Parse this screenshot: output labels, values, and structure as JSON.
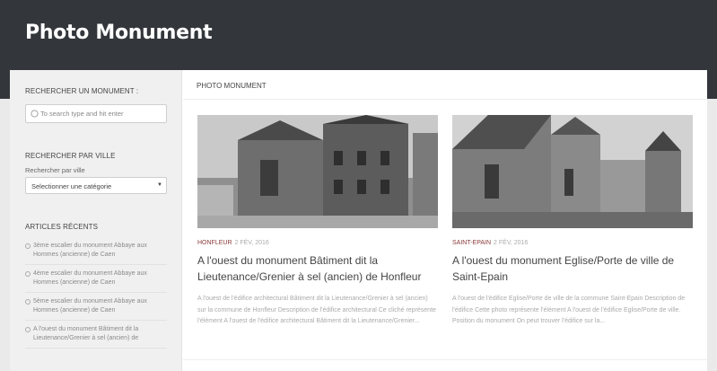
{
  "site": {
    "title": "Photo Monument"
  },
  "sidebar": {
    "search_heading": "RECHERCHER UN MONUMENT :",
    "search_placeholder": "To search type and hit enter",
    "city_heading": "RECHERCHER PAR VILLE",
    "city_label": "Rechercher par ville",
    "city_select_value": "Selectionner une catégorie",
    "recent_heading": "ARTICLES RÉCENTS",
    "recent": [
      {
        "text": "3ème escalier du monument Abbaye aux Hommes (ancienne) de Caen"
      },
      {
        "text": "4ème escalier du monument Abbaye aux Hommes (ancienne) de Caen"
      },
      {
        "text": "5ème escalier du monument Abbaye aux Hommes (ancienne) de Caen"
      },
      {
        "text": "A l'ouest du monument Bâtiment dit la Lieutenance/Grenier à sel (ancien) de"
      }
    ]
  },
  "main": {
    "breadcrumb": "PHOTO MONUMENT",
    "posts": [
      {
        "category": "HONFLEUR",
        "date": "2 FÉV, 2016",
        "title": "A l'ouest du monument Bâtiment dit la Lieutenance/Grenier à sel (ancien) de Honfleur",
        "excerpt": "A l'ouest de l'édifice architectural Bâtiment dit la Lieutenance/Grenier à sel (ancien) sur la commune de Honfleur Description de l'édifice architectural Ce cliché représente l'élément A l'ouest de l'édifice architectural Bâtiment dit la Lieutenance/Grenier..."
      },
      {
        "category": "SAINT-EPAIN",
        "date": "2 FÉV, 2016",
        "title": "A l'ouest du monument Eglise/Porte de ville de Saint-Epain",
        "excerpt": "A l'ouest de l'édifice Eglise/Porte de ville de la commune Saint-Epain Description de l'édifice Cette photo représente l'élément A l'ouest de l'édifice Eglise/Porte de ville. Position du monument On peut trouver l'édifice sur la..."
      }
    ]
  },
  "colors": {
    "header_bg": "#33363b",
    "accent": "#8b3a3a",
    "sidebar_bg": "#f0f0f0"
  },
  "icons": {
    "search": "search-icon",
    "recent_bullet": "circle-bullet-icon",
    "select_caret": "caret-down-icon"
  }
}
